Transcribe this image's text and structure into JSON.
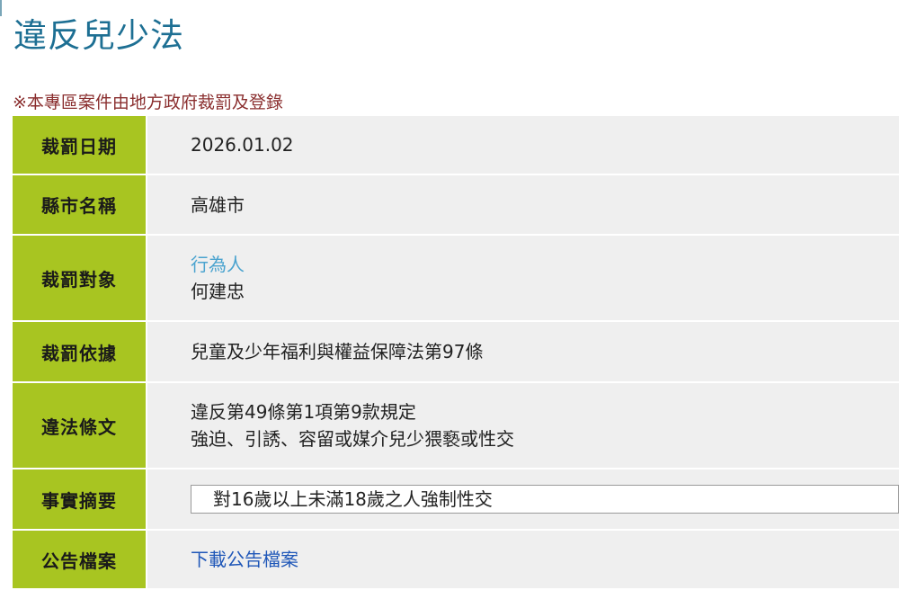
{
  "page": {
    "title": "違反兒少法",
    "notice": "※本專區案件由地方政府裁罰及登錄"
  },
  "record": {
    "rows": [
      {
        "label": "裁罰日期",
        "value": "2026.01.02"
      },
      {
        "label": "縣市名稱",
        "value": "高雄市"
      },
      {
        "label": "裁罰對象",
        "type": "行為人",
        "value": "何建忠"
      },
      {
        "label": "裁罰依據",
        "value": "兒童及少年福利與權益保障法第97條"
      },
      {
        "label": "違法條文",
        "line1": "違反第49條第1項第9款規定",
        "line2": "強迫、引誘、容留或媒介兒少猥褻或性交"
      },
      {
        "label": "事實摘要",
        "value": "對16歲以上未滿18歲之人強制性交"
      },
      {
        "label": "公告檔案",
        "link_label": "下載公告檔案"
      }
    ]
  },
  "colors": {
    "title": "#1d6f93",
    "notice": "#8a2e2e",
    "label_bg": "#a8c521",
    "value_bg": "#efefef",
    "link": "#1f57b8",
    "target_type": "#4aa3cf"
  }
}
